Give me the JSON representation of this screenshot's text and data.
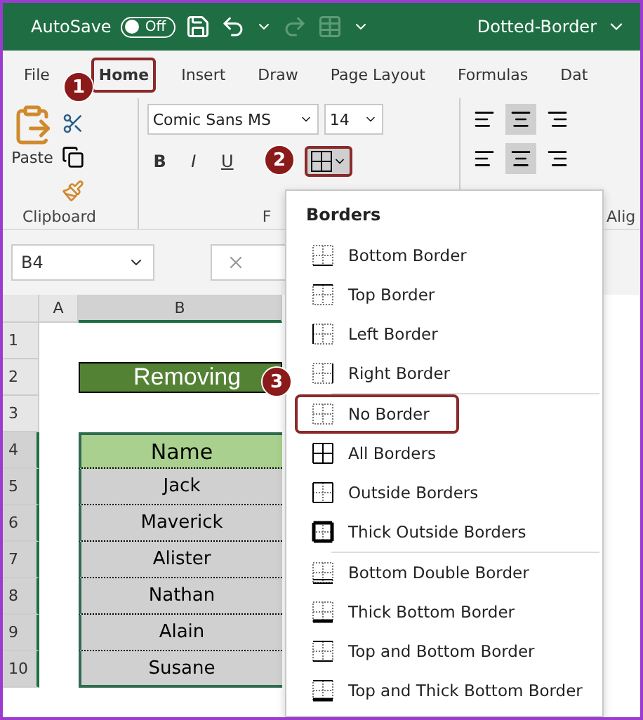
{
  "title_bar": {
    "autosave_label": "AutoSave",
    "autosave_toggle": {
      "label": "Off",
      "on": false
    },
    "file_name": "Dotted-Border"
  },
  "tabs": [
    {
      "label": "File",
      "selected": false,
      "highlighted": false
    },
    {
      "label": "Home",
      "selected": true,
      "highlighted": true
    },
    {
      "label": "Insert",
      "selected": false,
      "highlighted": false
    },
    {
      "label": "Draw",
      "selected": false,
      "highlighted": false
    },
    {
      "label": "Page Layout",
      "selected": false,
      "highlighted": false
    },
    {
      "label": "Formulas",
      "selected": false,
      "highlighted": false
    },
    {
      "label": "Dat",
      "selected": false,
      "highlighted": false
    }
  ],
  "ribbon": {
    "paste_label": "Paste",
    "font_name": "Comic Sans MS",
    "font_size": "14",
    "bold": "B",
    "italic": "I",
    "underline": "U",
    "groups": [
      "Clipboard",
      "F",
      "Alig"
    ]
  },
  "formula_bar": {
    "name_box": "B4"
  },
  "sheet": {
    "columns": [
      "A",
      "B"
    ],
    "rows": [
      "1",
      "2",
      "3",
      "4",
      "5",
      "6",
      "7",
      "8",
      "9",
      "10"
    ],
    "title": "Removing",
    "header": "Name",
    "names": [
      "Jack",
      "Maverick",
      "Alister",
      "Nathan",
      "Alain",
      "Susane"
    ]
  },
  "borders_menu": {
    "title": "Borders",
    "sections": [
      [
        {
          "label": "Bottom Border",
          "kind": "bottom",
          "highlighted": false
        },
        {
          "label": "Top Border",
          "kind": "top",
          "highlighted": false
        },
        {
          "label": "Left Border",
          "kind": "left",
          "highlighted": false
        },
        {
          "label": "Right Border",
          "kind": "right",
          "highlighted": false
        }
      ],
      [
        {
          "label": "No Border",
          "kind": "none",
          "highlighted": true
        },
        {
          "label": "All Borders",
          "kind": "all",
          "highlighted": false
        },
        {
          "label": "Outside Borders",
          "kind": "outside",
          "highlighted": false
        },
        {
          "label": "Thick Outside Borders",
          "kind": "thick_outside",
          "highlighted": false
        }
      ],
      [
        {
          "label": "Bottom Double Border",
          "kind": "bottom_double",
          "highlighted": false
        },
        {
          "label": "Thick Bottom Border",
          "kind": "thick_bottom",
          "highlighted": false
        },
        {
          "label": "Top and Bottom Border",
          "kind": "top_bottom",
          "highlighted": false
        },
        {
          "label": "Top and Thick Bottom Border",
          "kind": "top_thick_bottom",
          "highlighted": false
        }
      ]
    ]
  },
  "callouts": [
    "1",
    "2",
    "3"
  ]
}
